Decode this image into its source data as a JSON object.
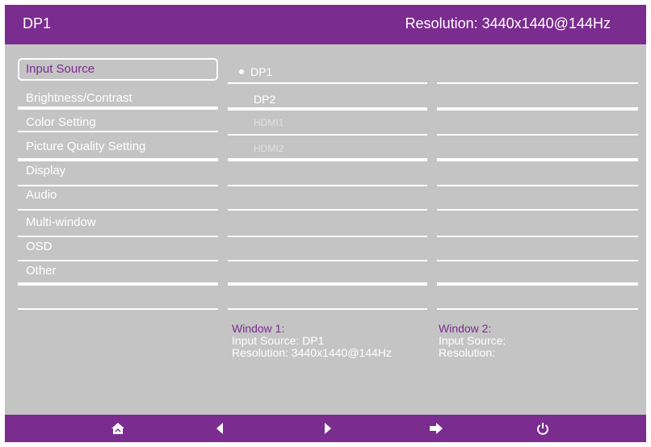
{
  "header": {
    "title": "DP1",
    "resolution": "Resolution: 3440x1440@144Hz"
  },
  "menu": {
    "items": [
      {
        "label": "Input Source",
        "selected": true
      },
      {
        "label": "Brightness/Contrast"
      },
      {
        "label": "Color Setting"
      },
      {
        "label": "Picture Quality Setting"
      },
      {
        "label": "Display"
      },
      {
        "label": "Audio"
      },
      {
        "label": "Multi-window"
      },
      {
        "label": "OSD"
      },
      {
        "label": "Other"
      }
    ]
  },
  "sources": {
    "items": [
      {
        "label": "DP1",
        "active": true
      },
      {
        "label": "DP2"
      },
      {
        "label": "HDMI1",
        "dim": true
      },
      {
        "label": "HDMI2",
        "dim": true
      }
    ]
  },
  "window1": {
    "title": "Window 1:",
    "input": "Input Source: DP1",
    "resolution": "Resolution: 3440x1440@144Hz"
  },
  "window2": {
    "title": "Window 2:",
    "input": "Input Source:",
    "resolution": "Resolution:"
  },
  "footer": {
    "buttons": [
      "home-icon",
      "arrow-left-icon",
      "arrow-right-icon",
      "enter-icon",
      "power-icon"
    ]
  },
  "colors": {
    "accent": "#7b2c8f",
    "panel": "#c4c4c4",
    "text": "#ffffff"
  }
}
